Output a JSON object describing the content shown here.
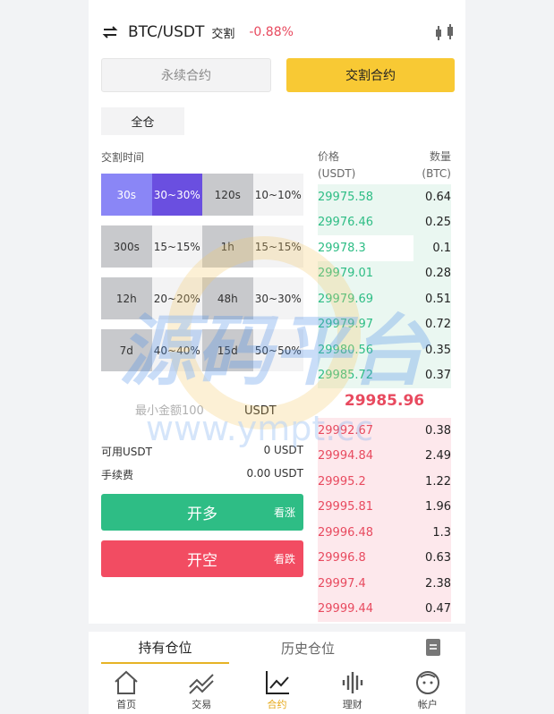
{
  "header": {
    "pair": "BTC/USDT",
    "type": "交割",
    "change": "-0.88%"
  },
  "tabs": {
    "perpetual": "永续合约",
    "delivery": "交割合约"
  },
  "margin_mode": "全仓",
  "time_label": "交割时间",
  "options": [
    {
      "time": "30s",
      "range": "30~30%"
    },
    {
      "time": "120s",
      "range": "10~10%"
    },
    {
      "time": "300s",
      "range": "15~15%"
    },
    {
      "time": "1h",
      "range": "15~15%"
    },
    {
      "time": "12h",
      "range": "20~20%"
    },
    {
      "time": "48h",
      "range": "30~30%"
    },
    {
      "time": "7d",
      "range": "40~40%"
    },
    {
      "time": "15d",
      "range": "50~50%"
    }
  ],
  "amount": {
    "placeholder": "最小金额100",
    "unit": "USDT"
  },
  "available": {
    "label": "可用USDT",
    "value": "0 USDT"
  },
  "fee": {
    "label": "手续费",
    "value": "0.00 USDT"
  },
  "long_btn": {
    "label": "开多",
    "sub": "看涨"
  },
  "short_btn": {
    "label": "开空",
    "sub": "看跌"
  },
  "orderbook": {
    "price_label": "价格",
    "price_unit": "(USDT)",
    "qty_label": "数量",
    "qty_unit": "(BTC)",
    "asks": [
      {
        "price": "29975.58",
        "qty": "0.64",
        "depth": 1.0
      },
      {
        "price": "29976.46",
        "qty": "0.25",
        "depth": 1.0
      },
      {
        "price": "29978.3",
        "qty": "0.1",
        "depth": 0.28
      },
      {
        "price": "29979.01",
        "qty": "0.28",
        "depth": 1.0
      },
      {
        "price": "29979.69",
        "qty": "0.51",
        "depth": 1.0
      },
      {
        "price": "29979.97",
        "qty": "0.72",
        "depth": 1.0
      },
      {
        "price": "29980.56",
        "qty": "0.35",
        "depth": 1.0
      },
      {
        "price": "29985.72",
        "qty": "0.37",
        "depth": 1.0
      }
    ],
    "last_price": "29985.96",
    "bids": [
      {
        "price": "29992.67",
        "qty": "0.38",
        "depth": 1.0
      },
      {
        "price": "29994.84",
        "qty": "2.49",
        "depth": 1.0
      },
      {
        "price": "29995.2",
        "qty": "1.22",
        "depth": 1.0
      },
      {
        "price": "29995.81",
        "qty": "1.96",
        "depth": 1.0
      },
      {
        "price": "29996.48",
        "qty": "1.3",
        "depth": 1.0
      },
      {
        "price": "29996.8",
        "qty": "0.63",
        "depth": 1.0
      },
      {
        "price": "29997.4",
        "qty": "2.38",
        "depth": 1.0
      },
      {
        "price": "29999.44",
        "qty": "0.47",
        "depth": 1.0
      }
    ]
  },
  "positions": {
    "holding": "持有仓位",
    "history": "历史仓位"
  },
  "nav": [
    {
      "label": "首页",
      "icon": "home-icon"
    },
    {
      "label": "交易",
      "icon": "trade-icon"
    },
    {
      "label": "合约",
      "icon": "contract-icon"
    },
    {
      "label": "理财",
      "icon": "finance-icon"
    },
    {
      "label": "帐户",
      "icon": "account-icon"
    }
  ],
  "watermark": {
    "title": "源码平台",
    "url": "www.ympt.cc"
  },
  "colors": {
    "accent": "#f8c934",
    "up": "#2ebd85",
    "down": "#e84a5f",
    "selected": "#6a4fe0"
  }
}
